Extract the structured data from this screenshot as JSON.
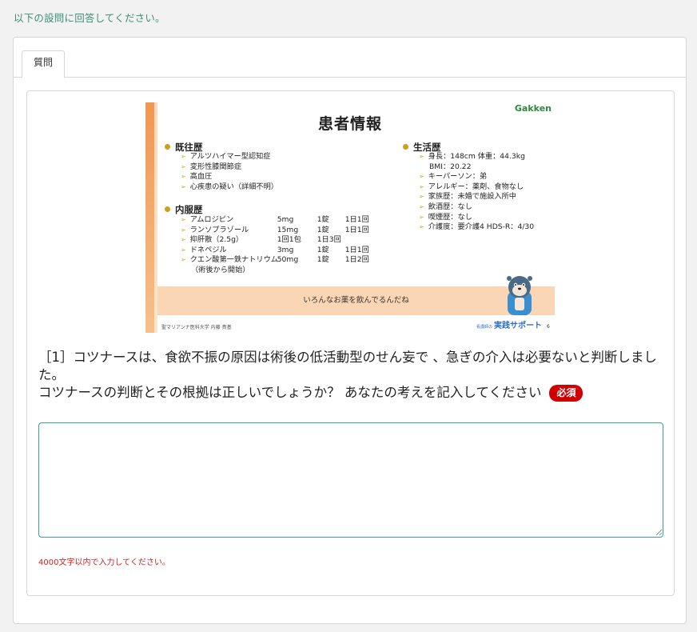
{
  "instruction": "以下の設問に回答してください。",
  "tab": {
    "label": "質問"
  },
  "slide": {
    "title": "患者情報",
    "brand": "Gakken",
    "history_heading": "既往歴",
    "history_items": [
      "アルツハイマー型認知症",
      "変形性膝関節症",
      "高血圧",
      "心疾患の疑い（詳細不明）"
    ],
    "meds_heading": "内服歴",
    "meds": [
      {
        "name": "アムロジピン",
        "dose": "5mg",
        "unit": "1錠",
        "freq": "1日1回"
      },
      {
        "name": "ランソプラゾール",
        "dose": "15mg",
        "unit": "1錠",
        "freq": "1日1回"
      },
      {
        "name": "抑肝散（2.5g）",
        "dose": "1回1包",
        "unit": "1日3回",
        "freq": ""
      },
      {
        "name": "ドネペジル",
        "dose": "3mg",
        "unit": "1錠",
        "freq": "1日1回"
      },
      {
        "name": "クエン酸第一鉄ナトリウム",
        "dose": "50mg",
        "unit": "1錠",
        "freq": "1日2回"
      }
    ],
    "meds_note": "（術後から開始）",
    "life_heading": "生活歴",
    "life_items": [
      "身長：148cm  体重：44.3kg",
      "BMI：20.22",
      "キーパーソン：弟",
      "アレルギー：薬剤、食物なし",
      "家族歴：未婚で施設入所中",
      "飲酒歴：なし",
      "喫煙歴：なし",
      "介護度：要介護4  HDS-R：4/30"
    ],
    "banner": "いろんなお薬を飲んでるんだね",
    "footer_left": "聖マリアンナ医科大学 内藤 貴基",
    "footer_logo_small": "看護師の",
    "footer_logo": "実践サポート",
    "page": "6"
  },
  "question": {
    "line1": "［1］コツナースは、食欲不振の原因は術後の低活動型のせん妄で 、急ぎの介入は必要ないと判断しました。",
    "line2": "コツナースの判断とその根拠は正しいでしょうか？ あなたの考えを記入してください",
    "required_label": "必須"
  },
  "answer": {
    "value": "",
    "placeholder": ""
  },
  "hint": "4000文字以内で入力してください。",
  "colors": {
    "accent": "#3aa394",
    "required": "#d10000",
    "banner": "#fbd6b5",
    "bullet": "#c8a21a"
  }
}
